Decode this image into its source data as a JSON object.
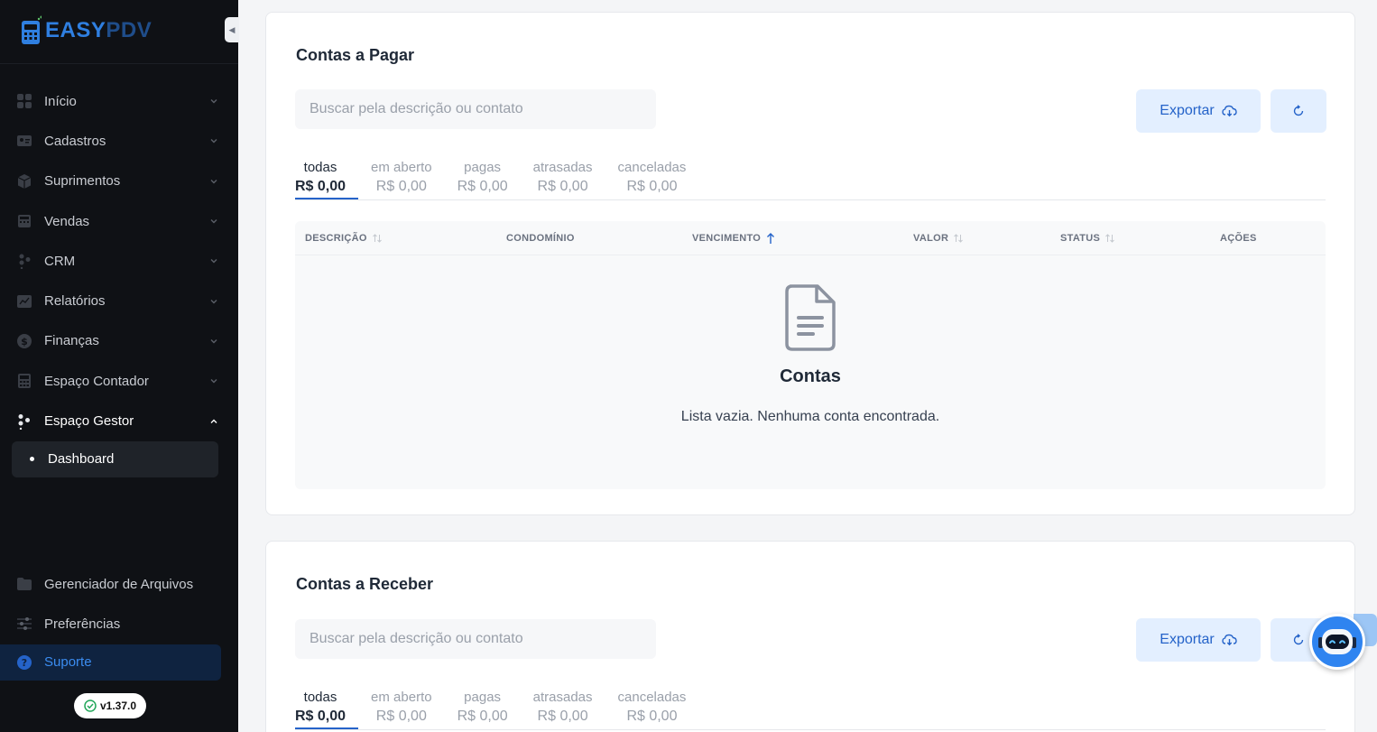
{
  "brand": {
    "name_part1": "EASY",
    "name_part2": "PDV"
  },
  "sidebar": {
    "items": [
      {
        "label": "Início",
        "icon": "grid-icon"
      },
      {
        "label": "Cadastros",
        "icon": "id-card-icon"
      },
      {
        "label": "Suprimentos",
        "icon": "box-icon"
      },
      {
        "label": "Vendas",
        "icon": "cash-register-icon"
      },
      {
        "label": "CRM",
        "icon": "users-icon"
      },
      {
        "label": "Relatórios",
        "icon": "chart-icon"
      },
      {
        "label": "Finanças",
        "icon": "dollar-icon"
      },
      {
        "label": "Espaço Contador",
        "icon": "calculator-icon"
      },
      {
        "label": "Espaço Gestor",
        "icon": "people-icon"
      }
    ],
    "sub_item": "Dashboard",
    "bottom": [
      {
        "label": "Gerenciador de Arquivos",
        "icon": "folder-icon"
      },
      {
        "label": "Preferências",
        "icon": "sliders-icon"
      }
    ],
    "support": "Suporte",
    "version": "v1.37.0"
  },
  "payables": {
    "title": "Contas a Pagar",
    "search_placeholder": "Buscar pela descrição ou contato",
    "export_label": "Exportar",
    "tabs": [
      {
        "label": "todas",
        "value": "R$ 0,00"
      },
      {
        "label": "em aberto",
        "value": "R$ 0,00"
      },
      {
        "label": "pagas",
        "value": "R$ 0,00"
      },
      {
        "label": "atrasadas",
        "value": "R$ 0,00"
      },
      {
        "label": "canceladas",
        "value": "R$ 0,00"
      }
    ],
    "columns": [
      "DESCRIÇÃO",
      "CONDOMÍNIO",
      "VENCIMENTO",
      "VALOR",
      "STATUS",
      "AÇÕES"
    ],
    "empty_title": "Contas",
    "empty_message": "Lista vazia. Nenhuma conta encontrada."
  },
  "receivables": {
    "title": "Contas a Receber",
    "search_placeholder": "Buscar pela descrição ou contato",
    "export_label": "Exportar",
    "tabs": [
      {
        "label": "todas",
        "value": "R$ 0,00"
      },
      {
        "label": "em aberto",
        "value": "R$ 0,00"
      },
      {
        "label": "pagas",
        "value": "R$ 0,00"
      },
      {
        "label": "atrasadas",
        "value": "R$ 0,00"
      },
      {
        "label": "canceladas",
        "value": "R$ 0,00"
      }
    ]
  },
  "colors": {
    "accent": "#2563c9",
    "sidebar_bg": "#0f1115",
    "export_bg": "#e3efff"
  }
}
